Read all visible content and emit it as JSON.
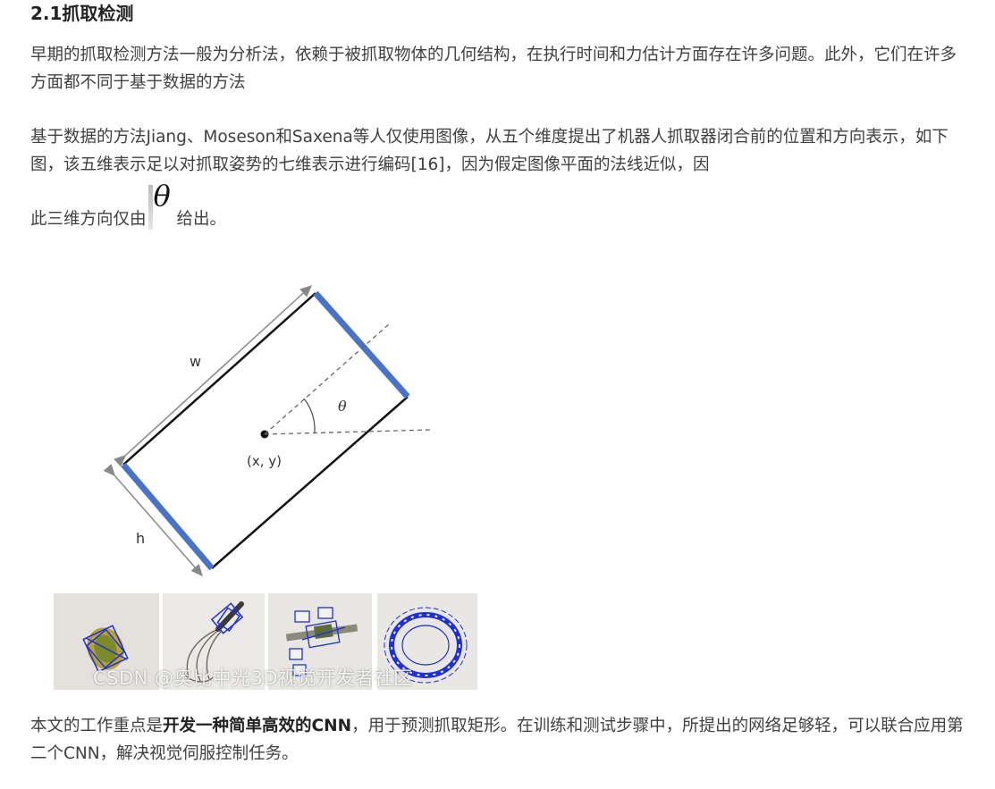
{
  "heading": "2.1抓取检测",
  "para1": "早期的抓取检测方法一般为分析法，依赖于被抓取物体的几何结构，在执行时间和力估计方面存在许多问题。此外，它们在许多方面都不同于基于数据的方法",
  "para2": "基于数据的方法Jiang、Moseson和Saxena等人仅使用图像，从五个维度提出了机器人抓取器闭合前的位置和方向表示，如下图，该五维表示足以对抓取姿势的七维表示进行编码[16]，因为假定图像平面的法线近似，因",
  "para3": {
    "before": "此三维方向仅由",
    "symbol": "θ",
    "after": "给出。"
  },
  "diagram": {
    "label_w": "w",
    "label_h": "h",
    "label_theta": "θ",
    "label_center": "(x, y)",
    "colors": {
      "edge": "#4a73c4",
      "line": "#111111",
      "arrow": "#888888"
    }
  },
  "photos": [
    "yellow-object-grasp",
    "whisk-grasp",
    "tool-grasp",
    "ring-grasp"
  ],
  "watermark": "CSDN @奥比中光3D视觉开发者社区",
  "para4": {
    "before": "本文的工作重点是",
    "bold": "开发一种简单高效的CNN",
    "after": "，用于预测抓取矩形。在训练和测试步骤中，所提出的网络足够轻，可以联合应用第二个CNN，解决视觉伺服控制任务。"
  }
}
